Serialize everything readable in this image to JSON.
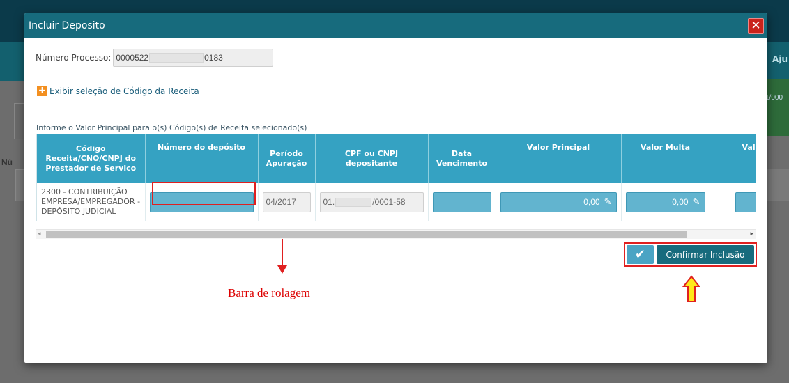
{
  "background": {
    "help_label": "Aju",
    "green_card_text": "1/000",
    "left_label": "Nú"
  },
  "modal": {
    "title": "Incluir Deposito",
    "close_label": "✕",
    "processo_label": "Número Processo:",
    "processo_prefix": "0000522",
    "processo_suffix": "0183",
    "expand_label": "Exibir seleção de Código da Receita",
    "info_label": "Informe o Valor Principal para o(s) Código(s) de Receita selecionado(s)"
  },
  "table": {
    "headers": [
      "Código Receita/CNO/CNPJ do Prestador de Servico",
      "Número do depósito",
      "Período Apuração",
      "CPF ou CNPJ depositante",
      "Data Vencimento",
      "Valor Principal",
      "Valor Multa",
      "Valor J"
    ],
    "row": {
      "codigo": "2300 - CONTRIBUIÇÃO EMPRESA/EMPREGADOR - DEPÓSITO JUDICIAL",
      "periodo": "04/2017",
      "cpf_prefix": "01.",
      "cpf_suffix": "/0001-58",
      "valor_principal": "0,00",
      "valor_multa": "0,00"
    }
  },
  "actions": {
    "confirm_label": "Confirmar Inclusão",
    "check_icon": "✔"
  },
  "annotation": {
    "scrollbar_text": "Barra de rolagem"
  },
  "colors": {
    "header": "#176b7d",
    "table_header": "#35a2c2",
    "input_blue": "#62b4cf",
    "highlight_red": "#e02020",
    "close_red": "#c9231b"
  }
}
